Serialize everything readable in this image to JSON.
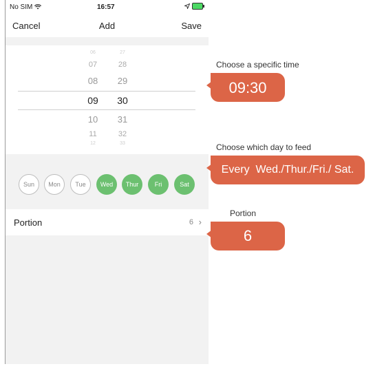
{
  "status_bar": {
    "carrier": "No SIM",
    "wifi_icon": "wifi-icon",
    "time": "16:57",
    "location_icon": "location-arrow-icon",
    "battery_icon": "battery-charging-icon"
  },
  "nav": {
    "cancel": "Cancel",
    "title": "Add",
    "save": "Save"
  },
  "picker": {
    "hours": [
      "06",
      "07",
      "08",
      "09",
      "10",
      "11",
      "12"
    ],
    "minutes": [
      "27",
      "28",
      "29",
      "30",
      "31",
      "32",
      "33"
    ],
    "selected_hour": "09",
    "selected_minute": "30"
  },
  "days": [
    {
      "label": "Sun",
      "selected": false
    },
    {
      "label": "Mon",
      "selected": false
    },
    {
      "label": "Tue",
      "selected": false
    },
    {
      "label": "Wed",
      "selected": true
    },
    {
      "label": "Thur",
      "selected": true
    },
    {
      "label": "Fri",
      "selected": true
    },
    {
      "label": "Sat",
      "selected": true
    }
  ],
  "portion_row": {
    "label": "Portion",
    "value": "6",
    "chevron_icon": "chevron-right-icon"
  },
  "callouts": {
    "time_caption": "Choose a specific time",
    "time_value": "09:30",
    "days_caption": "Choose which day to feed",
    "days_value": "Every  Wed./Thur./Fri./ Sat.",
    "portion_caption": "Portion",
    "portion_value": "6"
  },
  "colors": {
    "accent_green": "#6cc070",
    "callout_orange": "#dc6547"
  }
}
